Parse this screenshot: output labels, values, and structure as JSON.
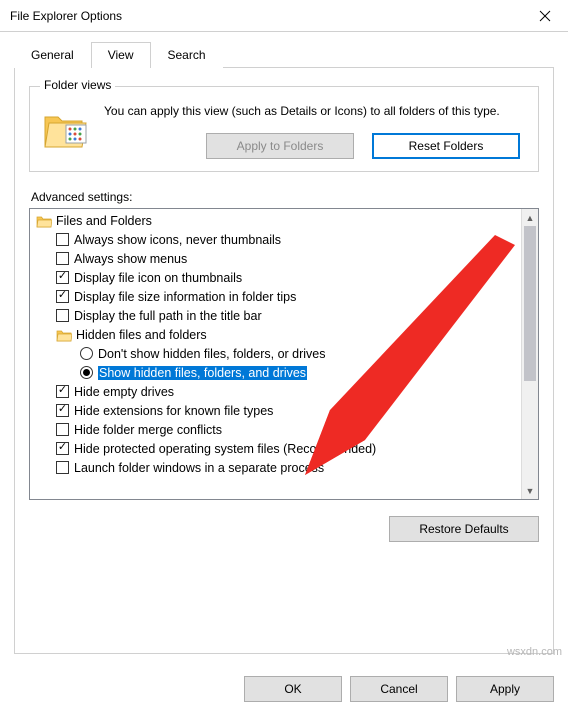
{
  "window": {
    "title": "File Explorer Options"
  },
  "tabs": {
    "general": "General",
    "view": "View",
    "search": "Search"
  },
  "folderViews": {
    "legend": "Folder views",
    "text": "You can apply this view (such as Details or Icons) to all folders of this type.",
    "applyBtn": "Apply to Folders",
    "resetBtn": "Reset Folders"
  },
  "advanced": {
    "label": "Advanced settings:",
    "rootLabel": "Files and Folders",
    "items": [
      {
        "type": "checkbox",
        "checked": false,
        "label": "Always show icons, never thumbnails"
      },
      {
        "type": "checkbox",
        "checked": false,
        "label": "Always show menus"
      },
      {
        "type": "checkbox",
        "checked": true,
        "label": "Display file icon on thumbnails"
      },
      {
        "type": "checkbox",
        "checked": true,
        "label": "Display file size information in folder tips"
      },
      {
        "type": "checkbox",
        "checked": false,
        "label": "Display the full path in the title bar"
      }
    ],
    "hiddenGroup": "Hidden files and folders",
    "hiddenOptions": [
      {
        "checked": false,
        "label": "Don't show hidden files, folders, or drives"
      },
      {
        "checked": true,
        "label": "Show hidden files, folders, and drives",
        "selected": true
      }
    ],
    "items2": [
      {
        "type": "checkbox",
        "checked": true,
        "label": "Hide empty drives"
      },
      {
        "type": "checkbox",
        "checked": true,
        "label": "Hide extensions for known file types"
      },
      {
        "type": "checkbox",
        "checked": false,
        "label": "Hide folder merge conflicts"
      },
      {
        "type": "checkbox",
        "checked": true,
        "label": "Hide protected operating system files (Recommended)"
      },
      {
        "type": "checkbox",
        "checked": false,
        "label": "Launch folder windows in a separate process"
      }
    ],
    "restoreBtn": "Restore Defaults"
  },
  "footer": {
    "ok": "OK",
    "cancel": "Cancel",
    "apply": "Apply"
  },
  "watermark": "wsxdn.com"
}
